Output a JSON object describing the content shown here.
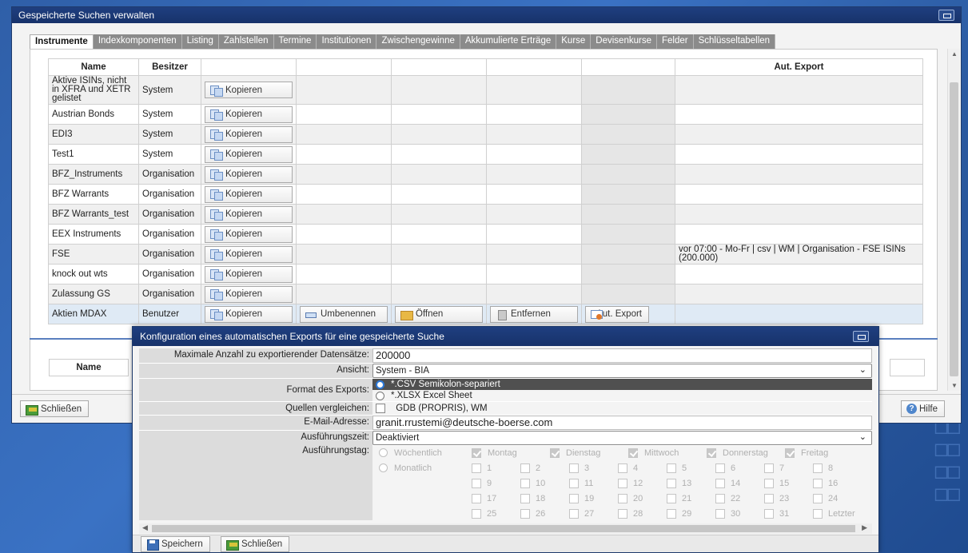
{
  "main_window": {
    "title": "Gespeicherte Suchen verwalten",
    "tabs": [
      "Instrumente",
      "Indexkomponenten",
      "Listing",
      "Zahlstellen",
      "Termine",
      "Institutionen",
      "Zwischengewinne",
      "Akkumulierte Erträge",
      "Kurse",
      "Devisenkurse",
      "Felder",
      "Schlüsseltabellen"
    ],
    "active_tab": "Instrumente",
    "columns": {
      "name": "Name",
      "owner": "Besitzer",
      "aut_export": "Aut. Export"
    },
    "copy_label": "Kopieren",
    "rows": [
      {
        "name": "Aktive ISINs, nicht in XFRA und XETR gelistet",
        "owner": "System",
        "aut_export": ""
      },
      {
        "name": "Austrian Bonds",
        "owner": "System",
        "aut_export": ""
      },
      {
        "name": "EDI3",
        "owner": "System",
        "aut_export": ""
      },
      {
        "name": "Test1",
        "owner": "System",
        "aut_export": ""
      },
      {
        "name": "BFZ_Instruments",
        "owner": "Organisation",
        "aut_export": ""
      },
      {
        "name": "BFZ Warrants",
        "owner": "Organisation",
        "aut_export": ""
      },
      {
        "name": "BFZ Warrants_test",
        "owner": "Organisation",
        "aut_export": ""
      },
      {
        "name": "EEX Instruments",
        "owner": "Organisation",
        "aut_export": ""
      },
      {
        "name": "FSE",
        "owner": "Organisation",
        "aut_export": "vor 07:00 - Mo-Fr | csv | WM | Organisation - FSE ISINs (200.000)"
      },
      {
        "name": "knock out wts",
        "owner": "Organisation",
        "aut_export": ""
      },
      {
        "name": "Zulassung GS",
        "owner": "Organisation",
        "aut_export": ""
      },
      {
        "name": "Aktien MDAX",
        "owner": "Benutzer",
        "aut_export": ""
      }
    ],
    "selected_row_actions": {
      "rename": "Umbenennen",
      "open": "Öffnen",
      "delete": "Entfernen",
      "export": "Aut. Export"
    },
    "second_header_name": "Name",
    "close_label": "Schließen",
    "help_label": "Hilfe"
  },
  "dialog": {
    "title": "Konfiguration eines automatischen Exports für eine gespeicherte Suche",
    "max_records_label": "Maximale Anzahl zu exportierender Datensätze:",
    "max_records_value": "200000",
    "view_label": "Ansicht:",
    "view_value": "System - BIA",
    "format_label": "Format des Exports:",
    "format_options": [
      "*.CSV Semikolon-separiert",
      "*.XLSX Excel Sheet"
    ],
    "sources_label": "Quellen vergleichen:",
    "sources_value": "GDB (PROPRIS), WM",
    "email_label": "E-Mail-Adresse:",
    "email_value": "granit.rrustemi@deutsche-boerse.com",
    "exec_time_label": "Ausführungszeit:",
    "exec_time_value": "Deaktiviert",
    "exec_day_label": "Ausführungstag:",
    "weekly_label": "Wöchentlich",
    "monthly_label": "Monatlich",
    "weekdays": [
      "Montag",
      "Dienstag",
      "Mittwoch",
      "Donnerstag",
      "Freitag"
    ],
    "month_days_row1": [
      "1",
      "2",
      "3",
      "4",
      "5",
      "6",
      "7",
      "8"
    ],
    "month_days_row2": [
      "9",
      "10",
      "11",
      "12",
      "13",
      "14",
      "15",
      "16"
    ],
    "month_days_row3": [
      "17",
      "18",
      "19",
      "20",
      "21",
      "22",
      "23",
      "24"
    ],
    "month_days_row4": [
      "25",
      "26",
      "27",
      "28",
      "29",
      "30",
      "31",
      "Letzter"
    ],
    "save_label": "Speichern",
    "close_label": "Schließen"
  },
  "colors": {
    "title_bar": "#1f3f80",
    "selected_row": "#dfeaf5",
    "selected_option": "#505050",
    "radio_accent": "#2b78d8"
  }
}
